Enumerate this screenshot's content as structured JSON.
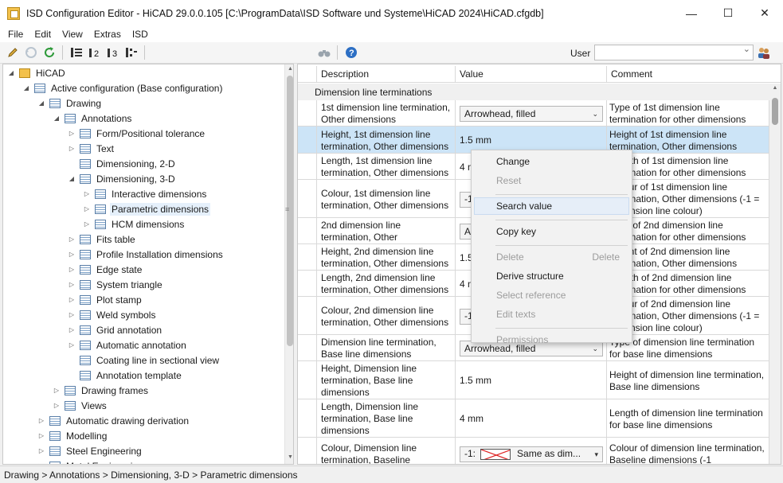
{
  "window": {
    "title": "ISD Configuration Editor  -  HiCAD 29.0.0.105 [C:\\ProgramData\\ISD Software und Systeme\\HiCAD 2024\\HiCAD.cfgdb]",
    "controls": {
      "minimize": "—",
      "maximize": "☐",
      "close": "✕"
    }
  },
  "menu": [
    "File",
    "Edit",
    "View",
    "Extras",
    "ISD"
  ],
  "toolbar": {
    "icons": [
      "pencil-icon",
      "undo-icon",
      "refresh-icon",
      "tree-level-1-icon",
      "tree-level-2-icon",
      "tree-level-3-icon",
      "expand-all-icon",
      "binoculars-icon",
      "help-icon",
      "users-icon"
    ],
    "user_label": "User",
    "user_value": ""
  },
  "tree": [
    {
      "label": "HiCAD",
      "depth": 0,
      "exp": "◢",
      "root": true
    },
    {
      "label": "Active configuration (Base configuration)",
      "depth": 1,
      "exp": "◢"
    },
    {
      "label": "Drawing",
      "depth": 2,
      "exp": "◢"
    },
    {
      "label": "Annotations",
      "depth": 3,
      "exp": "◢"
    },
    {
      "label": "Form/Positional tolerance",
      "depth": 4,
      "exp": "▷"
    },
    {
      "label": "Text",
      "depth": 4,
      "exp": "▷"
    },
    {
      "label": "Dimensioning, 2-D",
      "depth": 4,
      "exp": ""
    },
    {
      "label": "Dimensioning, 3-D",
      "depth": 4,
      "exp": "◢"
    },
    {
      "label": "Interactive dimensions",
      "depth": 5,
      "exp": "▷"
    },
    {
      "label": "Parametric dimensions",
      "depth": 5,
      "exp": "▷",
      "selected": true
    },
    {
      "label": "HCM dimensions",
      "depth": 5,
      "exp": "▷"
    },
    {
      "label": "Fits table",
      "depth": 4,
      "exp": "▷"
    },
    {
      "label": "Profile Installation dimensions",
      "depth": 4,
      "exp": "▷"
    },
    {
      "label": "Edge state",
      "depth": 4,
      "exp": "▷"
    },
    {
      "label": "System triangle",
      "depth": 4,
      "exp": "▷"
    },
    {
      "label": "Plot stamp",
      "depth": 4,
      "exp": "▷"
    },
    {
      "label": "Weld symbols",
      "depth": 4,
      "exp": "▷"
    },
    {
      "label": "Grid annotation",
      "depth": 4,
      "exp": "▷"
    },
    {
      "label": "Automatic annotation",
      "depth": 4,
      "exp": "▷"
    },
    {
      "label": "Coating line in sectional view",
      "depth": 4,
      "exp": ""
    },
    {
      "label": "Annotation template",
      "depth": 4,
      "exp": ""
    },
    {
      "label": "Drawing frames",
      "depth": 3,
      "exp": "▷"
    },
    {
      "label": "Views",
      "depth": 3,
      "exp": "▷"
    },
    {
      "label": "Automatic drawing derivation",
      "depth": 2,
      "exp": "▷"
    },
    {
      "label": "Modelling",
      "depth": 2,
      "exp": "▷"
    },
    {
      "label": "Steel Engineering",
      "depth": 2,
      "exp": "▷"
    },
    {
      "label": "Metal Engineering",
      "depth": 2,
      "exp": "▷"
    }
  ],
  "grid": {
    "headers": {
      "description": "Description",
      "value": "Value",
      "comment": "Comment"
    },
    "section": "Dimension line terminations",
    "rows": [
      {
        "desc": "1st dimension line termination, Other dimensions",
        "value": "Arrowhead, filled",
        "kind": "combo",
        "comment": "Type of 1st dimension line termination for other dimensions"
      },
      {
        "desc": "Height, 1st dimension line termination, Other dimensions",
        "value": "1.5 mm",
        "kind": "text",
        "comment": "Height of 1st dimension line termination, Other dimensions",
        "selected": true
      },
      {
        "desc": "Length, 1st dimension line termination, Other dimensions",
        "value": "4 mm",
        "kind": "text",
        "comment": "Length of 1st dimension line termination for other dimensions"
      },
      {
        "desc": "Colour, 1st dimension line termination, Other dimensions",
        "value": "-1:",
        "kind": "colour",
        "comment": "Colour of 1st dimension line termination, Other dimensions (-1 = dimension line colour)"
      },
      {
        "desc": "2nd dimension line termination, Other",
        "value": "Arrowhead, filled",
        "kind": "combo",
        "comment": "Type of 2nd dimension line termination for other dimensions"
      },
      {
        "desc": "Height, 2nd dimension line termination, Other dimensions",
        "value": "1.5 mm",
        "kind": "text",
        "comment": "Height of 2nd dimension line termination, Other dimensions"
      },
      {
        "desc": "Length, 2nd dimension line termination, Other dimensions",
        "value": "4 mm",
        "kind": "text",
        "comment": "Length of 2nd dimension line termination for other dimensions"
      },
      {
        "desc": "Colour, 2nd dimension line termination, Other dimensions",
        "value": "-1:",
        "kind": "colour",
        "comment": "Colour of 2nd dimension line termination, Other dimensions (-1 = dimension line colour)"
      },
      {
        "desc": "Dimension line termination, Base line dimensions",
        "value": "Arrowhead, filled",
        "kind": "combo",
        "comment": "Type of dimension line termination for base line dimensions"
      },
      {
        "desc": "Height, Dimension line termination, Base line dimensions",
        "value": "1.5 mm",
        "kind": "text",
        "comment": "Height of dimension line termination, Base line dimensions"
      },
      {
        "desc": "Length, Dimension line termination, Base line dimensions",
        "value": "4 mm",
        "kind": "text",
        "comment": "Length of dimension line termination for base line dimensions"
      },
      {
        "desc": "Colour, Dimension line termination, Baseline",
        "value": "-1:",
        "kind": "colour",
        "colour_text": "Same as dim...",
        "comment": "Colour of dimension line termination, Baseline dimensions (-1"
      }
    ]
  },
  "context_menu": {
    "items": [
      {
        "label": "Change",
        "enabled": true
      },
      {
        "label": "Reset",
        "enabled": false
      },
      {
        "sep": true
      },
      {
        "label": "Search value",
        "enabled": true,
        "hover": true
      },
      {
        "sep": true
      },
      {
        "label": "Copy key",
        "enabled": true
      },
      {
        "sep": true
      },
      {
        "label": "Delete",
        "enabled": false,
        "shortcut": "Delete"
      },
      {
        "label": "Derive structure",
        "enabled": true
      },
      {
        "label": "Select reference",
        "enabled": false
      },
      {
        "label": "Edit texts",
        "enabled": false
      },
      {
        "sep": true
      },
      {
        "label": "Permissions",
        "enabled": false
      }
    ]
  },
  "status": "Drawing > Annotations > Dimensioning, 3-D > Parametric dimensions"
}
